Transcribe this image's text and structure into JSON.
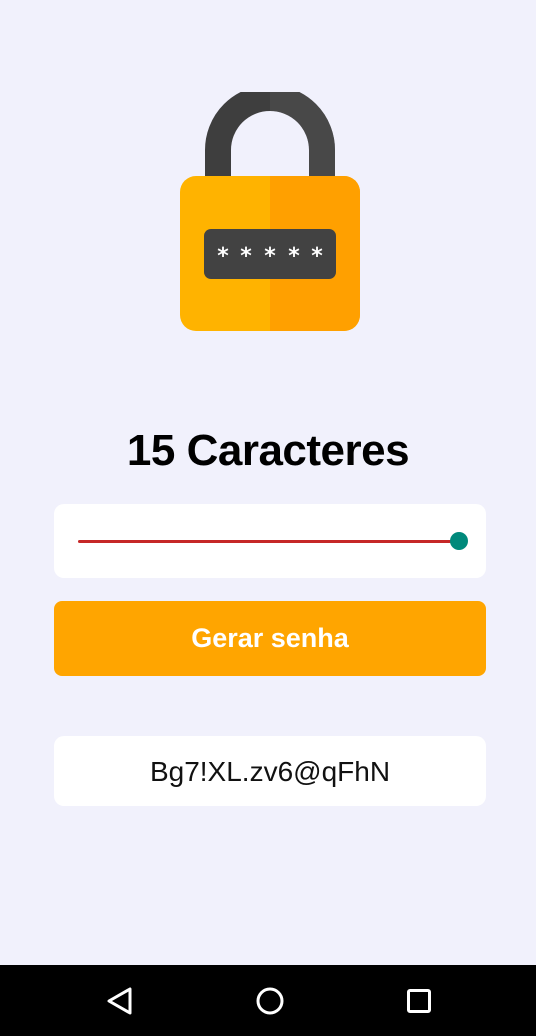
{
  "app": {
    "logo_icon": "padlock-password-icon",
    "length_title": "15 Caracteres",
    "slider": {
      "value_fraction": 1.0,
      "track_color": "#c62828",
      "thumb_color": "#00897b"
    },
    "generate_button_label": "Gerar senha",
    "generated_password": "Bg7!XL.zv6@qFhN"
  },
  "colors": {
    "background": "#f1f1fc",
    "accent": "#ffa500",
    "card": "#ffffff"
  },
  "navbar": {
    "back_icon": "back-triangle-icon",
    "home_icon": "home-circle-icon",
    "recent_icon": "recent-apps-square-icon"
  }
}
